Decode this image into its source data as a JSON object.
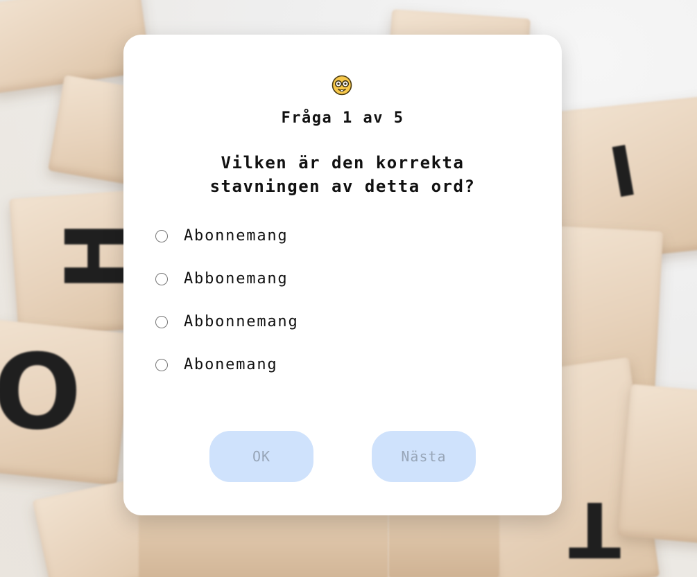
{
  "quiz": {
    "icon": "nerd-face-emoji-icon",
    "counter": "Fråga 1 av 5",
    "question": "Vilken är den korrekta stavningen av detta ord?",
    "options": [
      {
        "label": "Abonnemang"
      },
      {
        "label": "Abbonemang"
      },
      {
        "label": "Abbonnemang"
      },
      {
        "label": "Abonemang"
      }
    ],
    "buttons": {
      "ok_label": "OK",
      "next_label": "Nästa"
    }
  },
  "colors": {
    "card_background": "#ffffff",
    "button_background": "#cfe2fc",
    "button_text": "#98a6b8",
    "text": "#111111"
  }
}
